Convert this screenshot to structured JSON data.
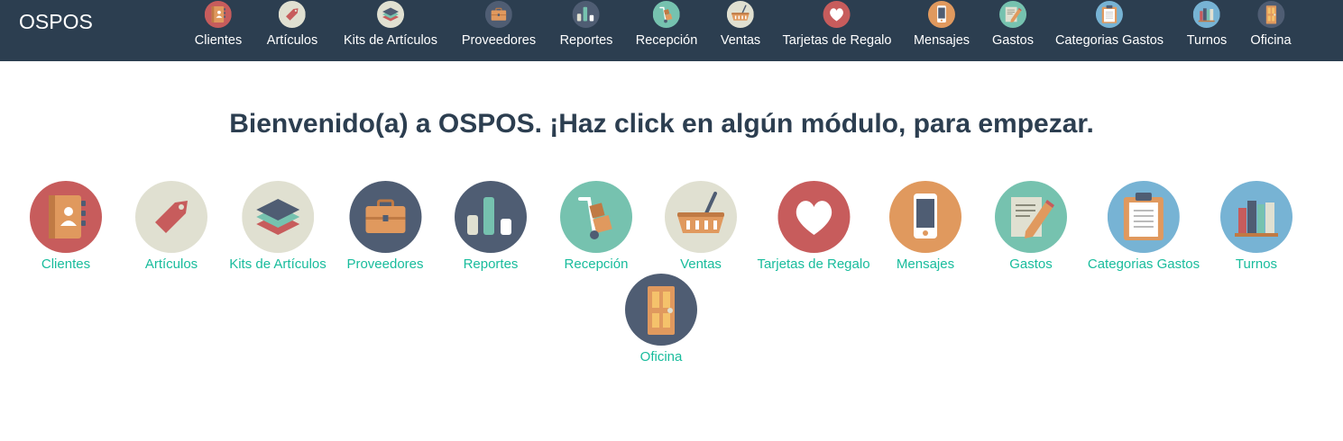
{
  "app": {
    "brand": "OSPOS"
  },
  "welcome_message": "Bienvenido(a) a OSPOS. ¡Haz click en algún módulo, para empezar.",
  "colors": {
    "navbar": "#2c3e50",
    "link": "#18bc9c",
    "text": "#2c3e50"
  },
  "modules": [
    {
      "key": "customers",
      "label": "Clientes",
      "icon": "address-book-icon",
      "bg": "#c75c5c"
    },
    {
      "key": "items",
      "label": "Artículos",
      "icon": "price-tag-icon",
      "bg": "#e0e0d1"
    },
    {
      "key": "item_kits",
      "label": "Kits de Artículos",
      "icon": "stacked-layers-icon",
      "bg": "#e0e0d1"
    },
    {
      "key": "suppliers",
      "label": "Proveedores",
      "icon": "briefcase-icon",
      "bg": "#4f5d73"
    },
    {
      "key": "reports",
      "label": "Reportes",
      "icon": "bar-chart-icon",
      "bg": "#4f5d73"
    },
    {
      "key": "receivings",
      "label": "Recepción",
      "icon": "hand-truck-icon",
      "bg": "#76c2af"
    },
    {
      "key": "sales",
      "label": "Ventas",
      "icon": "shopping-basket-icon",
      "bg": "#e0e0d1"
    },
    {
      "key": "giftcards",
      "label": "Tarjetas de Regalo",
      "icon": "heart-icon",
      "bg": "#c75c5c"
    },
    {
      "key": "messages",
      "label": "Mensajes",
      "icon": "mobile-phone-icon",
      "bg": "#e0995e"
    },
    {
      "key": "expenses",
      "label": "Gastos",
      "icon": "document-pencil-icon",
      "bg": "#76c2af"
    },
    {
      "key": "expenses_categories",
      "label": "Categorias Gastos",
      "icon": "clipboard-icon",
      "bg": "#77b3d4"
    },
    {
      "key": "cashups",
      "label": "Turnos",
      "icon": "books-icon",
      "bg": "#77b3d4"
    },
    {
      "key": "office",
      "label": "Oficina",
      "icon": "door-icon",
      "bg": "#4f5d73"
    }
  ]
}
